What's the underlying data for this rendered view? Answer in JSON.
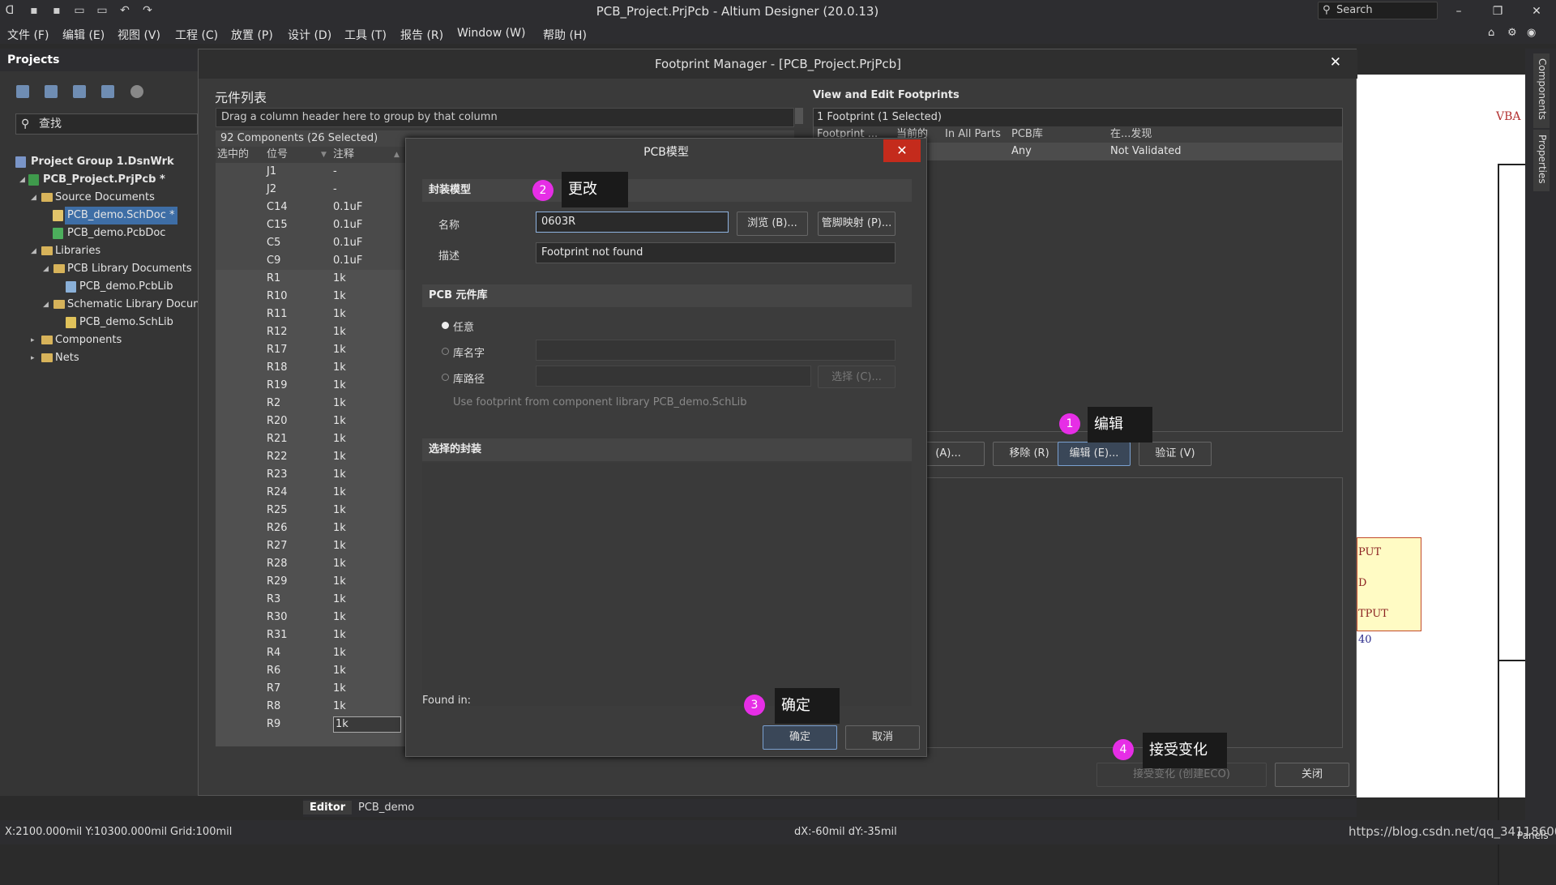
{
  "app": {
    "title": "PCB_Project.PrjPcb - Altium Designer (20.0.13)",
    "search_placeholder": "Search"
  },
  "menu": [
    "文件 (F)",
    "编辑 (E)",
    "视图 (V)",
    "工程 (C)",
    "放置 (P)",
    "设计 (D)",
    "工具 (T)",
    "报告 (R)",
    "Window (W)",
    "帮助 (H)"
  ],
  "projects": {
    "title": "Projects",
    "search_placeholder": "查找",
    "tree": [
      {
        "label": "Project Group 1.DsnWrk",
        "bold": true
      },
      {
        "label": "PCB_Project.PrjPcb *",
        "bold": true
      },
      {
        "label": "Source Documents"
      },
      {
        "label": "PCB_demo.SchDoc *",
        "selected": true
      },
      {
        "label": "PCB_demo.PcbDoc"
      },
      {
        "label": "Libraries"
      },
      {
        "label": "PCB Library Documents"
      },
      {
        "label": "PCB_demo.PcbLib"
      },
      {
        "label": "Schematic Library Docume"
      },
      {
        "label": "PCB_demo.SchLib"
      },
      {
        "label": "Components"
      },
      {
        "label": "Nets"
      }
    ]
  },
  "footprint_manager": {
    "title": "Footprint Manager - [PCB_Project.PrjPcb]",
    "component_list_title": "元件列表",
    "group_hint": "Drag a column header here to group by that column",
    "count": "92 Components (26 Selected)",
    "columns": [
      "选中的",
      "位号",
      "注释"
    ],
    "rows": [
      {
        "ref": "J1",
        "val": "-"
      },
      {
        "ref": "J2",
        "val": "-"
      },
      {
        "ref": "C14",
        "val": "0.1uF"
      },
      {
        "ref": "C15",
        "val": "0.1uF"
      },
      {
        "ref": "C5",
        "val": "0.1uF"
      },
      {
        "ref": "C9",
        "val": "0.1uF"
      },
      {
        "ref": "R1",
        "val": "1k"
      },
      {
        "ref": "R10",
        "val": "1k"
      },
      {
        "ref": "R11",
        "val": "1k"
      },
      {
        "ref": "R12",
        "val": "1k"
      },
      {
        "ref": "R17",
        "val": "1k"
      },
      {
        "ref": "R18",
        "val": "1k"
      },
      {
        "ref": "R19",
        "val": "1k"
      },
      {
        "ref": "R2",
        "val": "1k"
      },
      {
        "ref": "R20",
        "val": "1k"
      },
      {
        "ref": "R21",
        "val": "1k"
      },
      {
        "ref": "R22",
        "val": "1k"
      },
      {
        "ref": "R23",
        "val": "1k"
      },
      {
        "ref": "R24",
        "val": "1k"
      },
      {
        "ref": "R25",
        "val": "1k"
      },
      {
        "ref": "R26",
        "val": "1k"
      },
      {
        "ref": "R27",
        "val": "1k"
      },
      {
        "ref": "R28",
        "val": "1k"
      },
      {
        "ref": "R29",
        "val": "1k"
      },
      {
        "ref": "R3",
        "val": "1k"
      },
      {
        "ref": "R30",
        "val": "1k"
      },
      {
        "ref": "R31",
        "val": "1k"
      },
      {
        "ref": "R4",
        "val": "1k"
      },
      {
        "ref": "R6",
        "val": "1k"
      },
      {
        "ref": "R7",
        "val": "1k"
      },
      {
        "ref": "R8",
        "val": "1k"
      },
      {
        "ref": "R9",
        "val": "1k"
      }
    ],
    "view_edit_title": "View and Edit Footprints",
    "fp_count": "1 Footprint (1 Selected)",
    "fp_columns": [
      "Footprint ...",
      "当前的",
      "In All Parts",
      "PCB库",
      "在...发现"
    ],
    "fp_row": {
      "lib": "Any",
      "found": "Not Validated"
    },
    "buttons": {
      "add": "(A)...",
      "remove": "移除 (R)",
      "edit": "编辑 (E)...",
      "validate": "验证 (V)",
      "accept": "接受变化 (创建ECO)",
      "close": "关闭"
    }
  },
  "pcb_model": {
    "title": "PCB模型",
    "section_footprint": "封装模型",
    "name_label": "名称",
    "name_value": "0603R",
    "browse": "浏览 (B)...",
    "pin_map": "管脚映射 (P)...",
    "desc_label": "描述",
    "desc_value": "Footprint not found",
    "section_lib": "PCB 元件库",
    "opt_any": "任意",
    "opt_libname": "库名字",
    "opt_libpath": "库路径",
    "choose": "选择 (C)...",
    "use_comp_lib": "Use footprint from component library PCB_demo.SchLib",
    "section_selected": "选择的封装",
    "found_in": "Found in:",
    "ok": "确定",
    "cancel": "取消"
  },
  "callouts": [
    {
      "num": "1",
      "text": "编辑"
    },
    {
      "num": "2",
      "text": "更改"
    },
    {
      "num": "3",
      "text": "确定"
    },
    {
      "num": "4",
      "text": "接受变化"
    }
  ],
  "canvas_labels": [
    "VBA",
    "PUT",
    "D",
    "TPUT",
    "40"
  ],
  "right_tabs": [
    "Components",
    "Properties"
  ],
  "doc_tabs": [
    "Editor",
    "PCB_demo"
  ],
  "status": {
    "coords": "X:2100.000mil Y:10300.000mil",
    "grid": "Grid:100mil",
    "delta": "dX:-60mil dY:-35mil",
    "watermark": "https://blog.csdn.net/qq_34118600",
    "panels": "Panels"
  }
}
